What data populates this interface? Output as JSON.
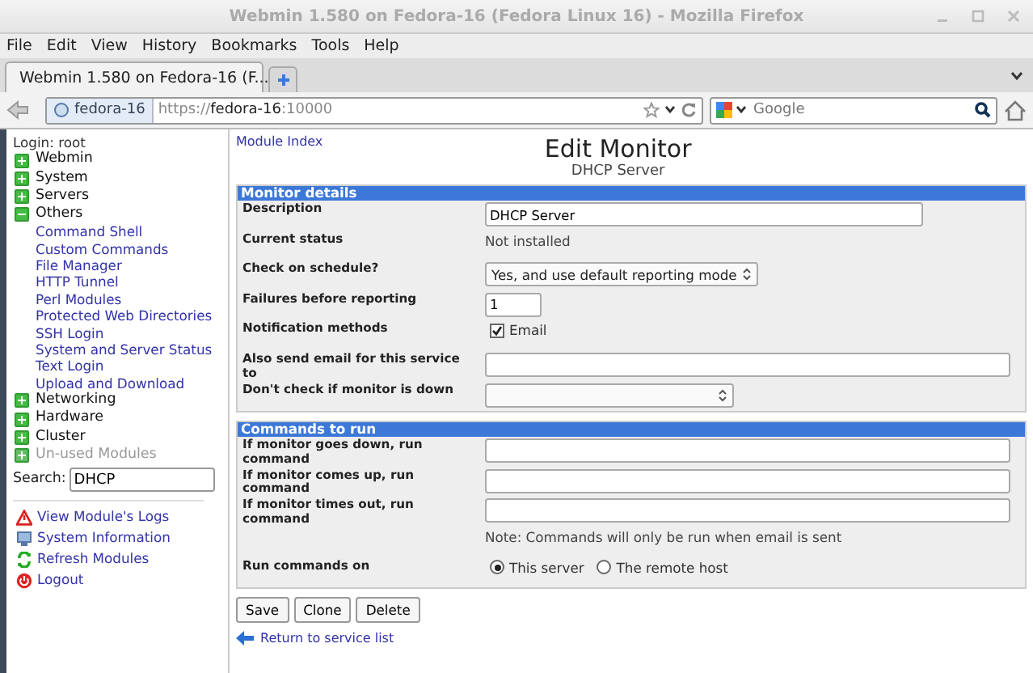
{
  "window": {
    "title": "Webmin 1.580 on Fedora-16 (Fedora Linux 16) - Mozilla Firefox"
  },
  "menu": [
    "File",
    "Edit",
    "View",
    "History",
    "Bookmarks",
    "Tools",
    "Help"
  ],
  "tab": {
    "title": "Webmin 1.580 on Fedora-16 (F...",
    "selected": true
  },
  "address": {
    "site": "fedora-16",
    "scheme": "https://",
    "host": "fedora-16",
    "port": ":10000"
  },
  "search": {
    "placeholder": "Google"
  },
  "sidebar": {
    "login": "Login: root",
    "categories": [
      {
        "label": "Webmin",
        "expanded": false,
        "disabled": false
      },
      {
        "label": "System",
        "expanded": false,
        "disabled": false
      },
      {
        "label": "Servers",
        "expanded": false,
        "disabled": false
      },
      {
        "label": "Others",
        "expanded": true,
        "disabled": false,
        "children": [
          "Command Shell",
          "Custom Commands",
          "File Manager",
          "HTTP Tunnel",
          "Perl Modules",
          "Protected Web Directories",
          "SSH Login",
          "System and Server Status",
          "Text Login",
          "Upload and Download"
        ]
      },
      {
        "label": "Networking",
        "expanded": false,
        "disabled": false
      },
      {
        "label": "Hardware",
        "expanded": false,
        "disabled": false
      },
      {
        "label": "Cluster",
        "expanded": false,
        "disabled": false
      },
      {
        "label": "Un-used Modules",
        "expanded": false,
        "disabled": true
      }
    ],
    "search": {
      "label": "Search:",
      "value": "DHCP"
    },
    "actions": [
      {
        "label": "View Module's Logs",
        "kind": "warning"
      },
      {
        "label": "System Information",
        "kind": "info"
      },
      {
        "label": "Refresh Modules",
        "kind": "refresh"
      },
      {
        "label": "Logout",
        "kind": "logout"
      }
    ]
  },
  "main": {
    "module_index": "Module Index",
    "title": "Edit Monitor",
    "subtitle": "DHCP Server",
    "sections": [
      {
        "title": "Monitor details",
        "rows": [
          {
            "label": "Description",
            "kind": "short_text",
            "value": "DHCP Server"
          },
          {
            "label": "Current status",
            "kind": "status",
            "value": "Not installed"
          },
          {
            "label": "Check on schedule?",
            "kind": "select",
            "value": "Yes, and use default reporting mode"
          },
          {
            "label": "Failures before reporting",
            "kind": "number",
            "value": "1"
          },
          {
            "label": "Notification methods",
            "kind": "checkbox",
            "options": [
              {
                "label": "Email",
                "checked": true
              }
            ]
          },
          {
            "label": "Also send email for this service to",
            "kind": "text",
            "value": ""
          },
          {
            "label": "Don't check if monitor is down",
            "kind": "select",
            "value": ""
          }
        ]
      },
      {
        "title": "Commands to run",
        "rows": [
          {
            "label": "If monitor goes down, run command",
            "kind": "text",
            "value": ""
          },
          {
            "label": "If monitor comes up, run command",
            "kind": "text",
            "value": ""
          },
          {
            "label": "If monitor times out, run command",
            "kind": "text",
            "value": ""
          },
          {
            "label": "",
            "kind": "note",
            "value": "Note: Commands will only be run when email is sent"
          },
          {
            "label": "Run commands on",
            "kind": "radio",
            "options": [
              {
                "label": "This server",
                "selected": true
              },
              {
                "label": "The remote host",
                "selected": false
              }
            ]
          }
        ]
      }
    ],
    "buttons": [
      "Save",
      "Clone",
      "Delete"
    ],
    "return_link": "Return to service list"
  }
}
